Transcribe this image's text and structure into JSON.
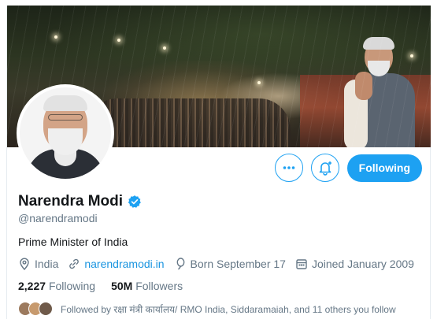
{
  "profile": {
    "name": "Narendra Modi",
    "handle": "@narendramodi",
    "bio": "Prime Minister of India",
    "location": "India",
    "website": "narendramodi.in",
    "born": "Born September 17",
    "joined": "Joined January 2009"
  },
  "stats": {
    "following_count": "2,227",
    "following_label": "Following",
    "followers_count": "50M",
    "followers_label": "Followers"
  },
  "followed_by": "Followed by रक्षा मंत्री कार्यालय/ RMO India, Siddaramaiah, and 11 others you follow",
  "actions": {
    "follow_label": "Following"
  },
  "colors": {
    "accent": "#1da1f2",
    "link": "#1b95e0",
    "verified": "#1da1f2",
    "muted": "#657786"
  },
  "icons": [
    "more-options-icon",
    "notification-bell-icon",
    "verified-badge-icon",
    "location-icon",
    "link-icon",
    "birthday-balloon-icon",
    "calendar-icon"
  ]
}
